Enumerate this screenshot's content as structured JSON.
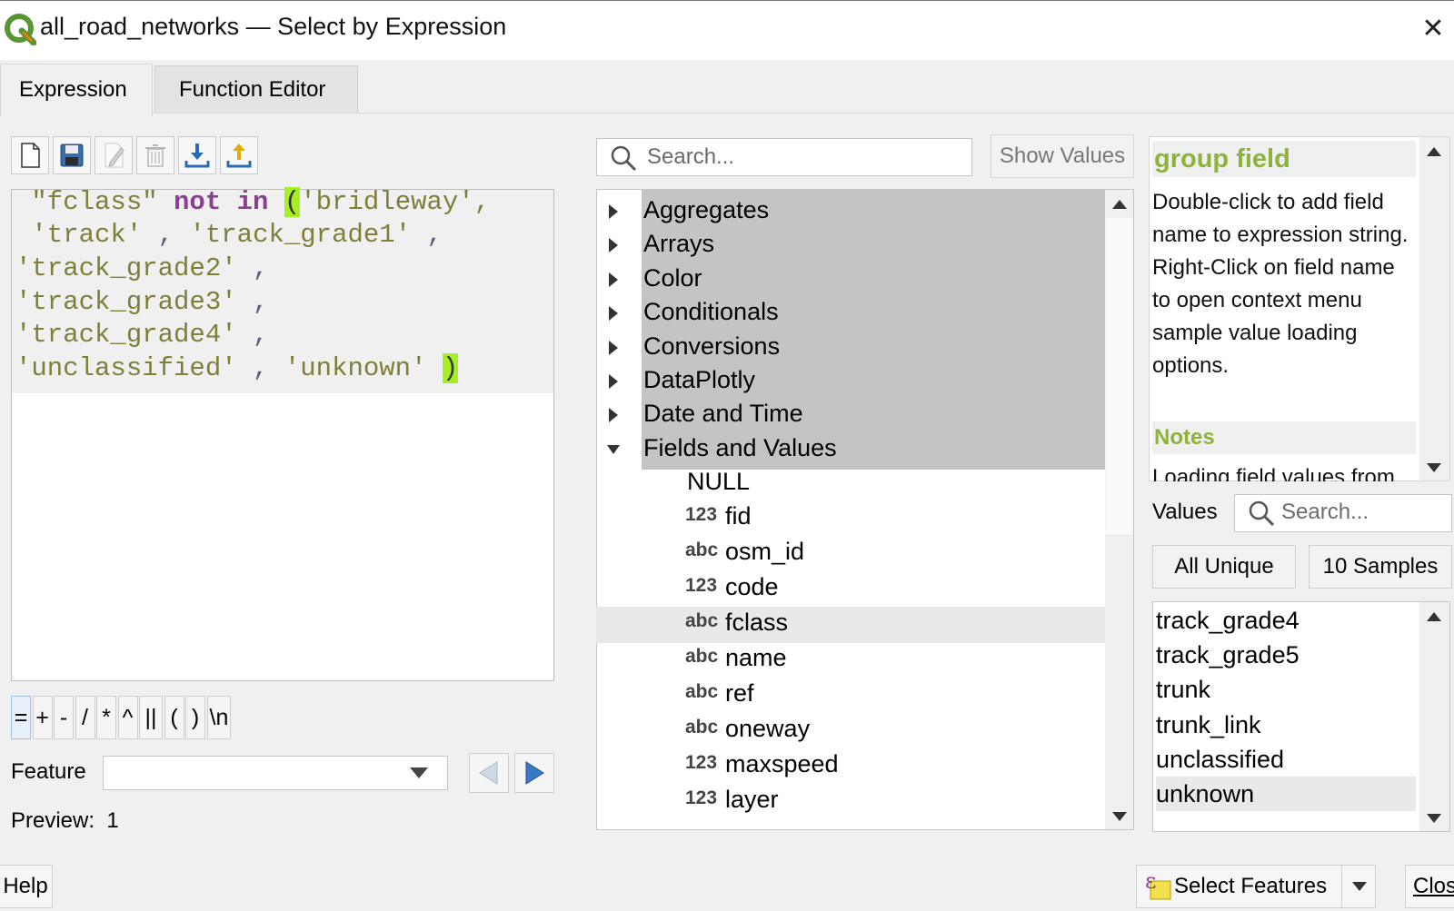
{
  "window": {
    "title": "all_road_networks — Select by Expression",
    "close_glyph": "✕"
  },
  "tabs": [
    {
      "label": "Expression",
      "active": true
    },
    {
      "label": "Function Editor",
      "active": false
    }
  ],
  "toolbar_icons": [
    "new-file-icon",
    "save-icon",
    "edit-icon",
    "delete-icon",
    "import-icon",
    "export-icon"
  ],
  "editor": {
    "lines": [
      [
        {
          "t": " \"fclass\" ",
          "c": "str"
        },
        {
          "t": "not",
          "c": "kw"
        },
        {
          "t": " ",
          "c": ""
        },
        {
          "t": "in",
          "c": "kw"
        },
        {
          "t": " ",
          "c": ""
        },
        {
          "t": "(",
          "c": "paren-hl"
        },
        {
          "t": "'bridleway',",
          "c": "str"
        }
      ],
      [
        {
          "t": " 'track'",
          "c": "str"
        },
        {
          "t": " , ",
          "c": "op"
        },
        {
          "t": "'track_grade1'",
          "c": "str"
        },
        {
          "t": " ,",
          "c": "op"
        }
      ],
      [
        {
          "t": "'track_grade2'",
          "c": "str"
        },
        {
          "t": " ,",
          "c": "op"
        }
      ],
      [
        {
          "t": "'track_grade3'",
          "c": "str"
        },
        {
          "t": " ,",
          "c": "op"
        }
      ],
      [
        {
          "t": "'track_grade4'",
          "c": "str"
        },
        {
          "t": " ,",
          "c": "op"
        }
      ],
      [
        {
          "t": "'unclassified'",
          "c": "str"
        },
        {
          "t": " , ",
          "c": "op"
        },
        {
          "t": "'unknown'",
          "c": "str"
        },
        {
          "t": " ",
          "c": ""
        },
        {
          "t": ")",
          "c": "paren-hl"
        }
      ]
    ]
  },
  "operators": [
    "=",
    "+",
    "-",
    "/",
    "*",
    "^",
    "||",
    "(",
    ")",
    "\\n"
  ],
  "feature": {
    "label": "Feature",
    "value": ""
  },
  "preview": {
    "label": "Preview:",
    "value": "1"
  },
  "function_tree": {
    "search_placeholder": "Search...",
    "show_values_label": "Show Values",
    "groups": [
      {
        "label": "Aggregates",
        "expanded": false
      },
      {
        "label": "Arrays",
        "expanded": false
      },
      {
        "label": "Color",
        "expanded": false
      },
      {
        "label": "Conditionals",
        "expanded": false
      },
      {
        "label": "Conversions",
        "expanded": false
      },
      {
        "label": "DataPlotly",
        "expanded": false
      },
      {
        "label": "Date and Time",
        "expanded": false
      },
      {
        "label": "Fields and Values",
        "expanded": true
      }
    ],
    "fields": [
      {
        "type": "",
        "name": "NULL"
      },
      {
        "type": "123",
        "name": "fid"
      },
      {
        "type": "abc",
        "name": "osm_id"
      },
      {
        "type": "123",
        "name": "code"
      },
      {
        "type": "abc",
        "name": "fclass",
        "selected": true
      },
      {
        "type": "abc",
        "name": "name"
      },
      {
        "type": "abc",
        "name": "ref"
      },
      {
        "type": "abc",
        "name": "oneway"
      },
      {
        "type": "123",
        "name": "maxspeed"
      },
      {
        "type": "123",
        "name": "layer"
      }
    ]
  },
  "help": {
    "title": "group field",
    "body": "Double-click to add field name to expression string. Right-Click on field name to open context menu sample value loading options.",
    "notes_heading": "Notes",
    "notes_text": "Loading field values from"
  },
  "values": {
    "label": "Values",
    "search_placeholder": "Search...",
    "all_unique_label": "All Unique",
    "samples_label": "10 Samples",
    "items": [
      "track_grade4",
      "track_grade5",
      "trunk",
      "trunk_link",
      "unclassified",
      "unknown"
    ],
    "selected": "unknown"
  },
  "buttons": {
    "help": "Help",
    "select_features": "Select Features",
    "close": "Close"
  },
  "colors": {
    "accent_green": "#8db33a",
    "paren_highlight": "#a6ef24",
    "keyword": "#8b3f8f"
  }
}
